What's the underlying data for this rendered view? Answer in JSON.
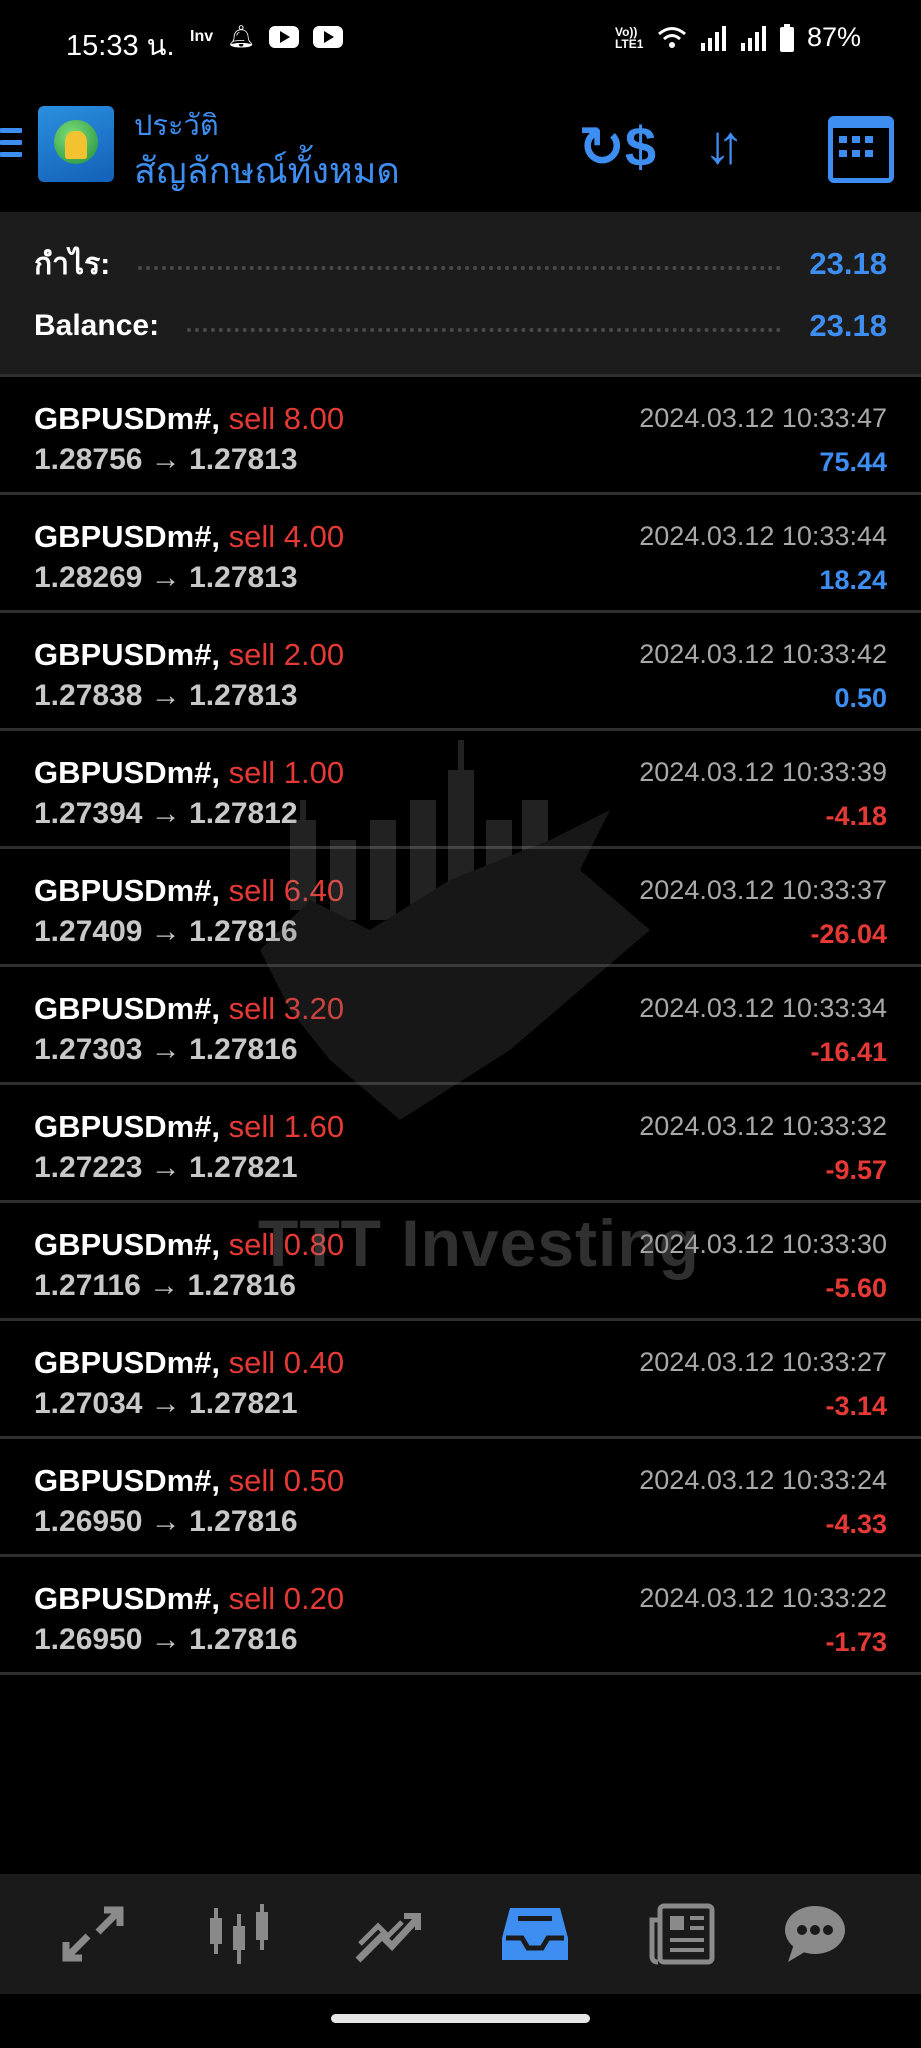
{
  "status_bar": {
    "time": "15:33 น.",
    "inv_label": "Inv",
    "network": "Vo)) LTE1",
    "battery": "87%"
  },
  "header": {
    "title": "ประวัติ",
    "subtitle": "สัญลักษณ์ทั้งหมด"
  },
  "summary": [
    {
      "label": "กำไร:",
      "value": "23.18"
    },
    {
      "label": "Balance:",
      "value": "23.18"
    }
  ],
  "deals": [
    {
      "symbol": "GBPUSDm#,",
      "side": "sell 8.00",
      "prices": "1.28756 → 1.27813",
      "time": "2024.03.12 10:33:47",
      "profit": "75.44"
    },
    {
      "symbol": "GBPUSDm#,",
      "side": "sell 4.00",
      "prices": "1.28269 → 1.27813",
      "time": "2024.03.12 10:33:44",
      "profit": "18.24"
    },
    {
      "symbol": "GBPUSDm#,",
      "side": "sell 2.00",
      "prices": "1.27838 → 1.27813",
      "time": "2024.03.12 10:33:42",
      "profit": "0.50"
    },
    {
      "symbol": "GBPUSDm#,",
      "side": "sell 1.00",
      "prices": "1.27394 → 1.27812",
      "time": "2024.03.12 10:33:39",
      "profit": "-4.18"
    },
    {
      "symbol": "GBPUSDm#,",
      "side": "sell 6.40",
      "prices": "1.27409 → 1.27816",
      "time": "2024.03.12 10:33:37",
      "profit": "-26.04"
    },
    {
      "symbol": "GBPUSDm#,",
      "side": "sell 3.20",
      "prices": "1.27303 → 1.27816",
      "time": "2024.03.12 10:33:34",
      "profit": "-16.41"
    },
    {
      "symbol": "GBPUSDm#,",
      "side": "sell 1.60",
      "prices": "1.27223 → 1.27821",
      "time": "2024.03.12 10:33:32",
      "profit": "-9.57"
    },
    {
      "symbol": "GBPUSDm#,",
      "side": "sell 0.80",
      "prices": "1.27116 → 1.27816",
      "time": "2024.03.12 10:33:30",
      "profit": "-5.60"
    },
    {
      "symbol": "GBPUSDm#,",
      "side": "sell 0.40",
      "prices": "1.27034 → 1.27821",
      "time": "2024.03.12 10:33:27",
      "profit": "-3.14"
    },
    {
      "symbol": "GBPUSDm#,",
      "side": "sell 0.50",
      "prices": "1.26950 → 1.27816",
      "time": "2024.03.12 10:33:24",
      "profit": "-4.33"
    },
    {
      "symbol": "GBPUSDm#,",
      "side": "sell 0.20",
      "prices": "1.26950 → 1.27816",
      "time": "2024.03.12 10:33:22",
      "profit": "-1.73"
    }
  ],
  "watermark": {
    "text": "TTT Investing"
  },
  "bottom_nav": [
    {
      "icon": "quotes-icon",
      "active": false
    },
    {
      "icon": "chart-candles-icon",
      "active": false
    },
    {
      "icon": "trade-icon",
      "active": false
    },
    {
      "icon": "history-inbox-icon",
      "active": true
    },
    {
      "icon": "news-icon",
      "active": false
    },
    {
      "icon": "chat-icon",
      "active": false
    }
  ],
  "colors": {
    "accent": "#3d8ef0",
    "negative": "#e53935",
    "background": "#000000",
    "summary_bg": "#1c1c1c"
  }
}
